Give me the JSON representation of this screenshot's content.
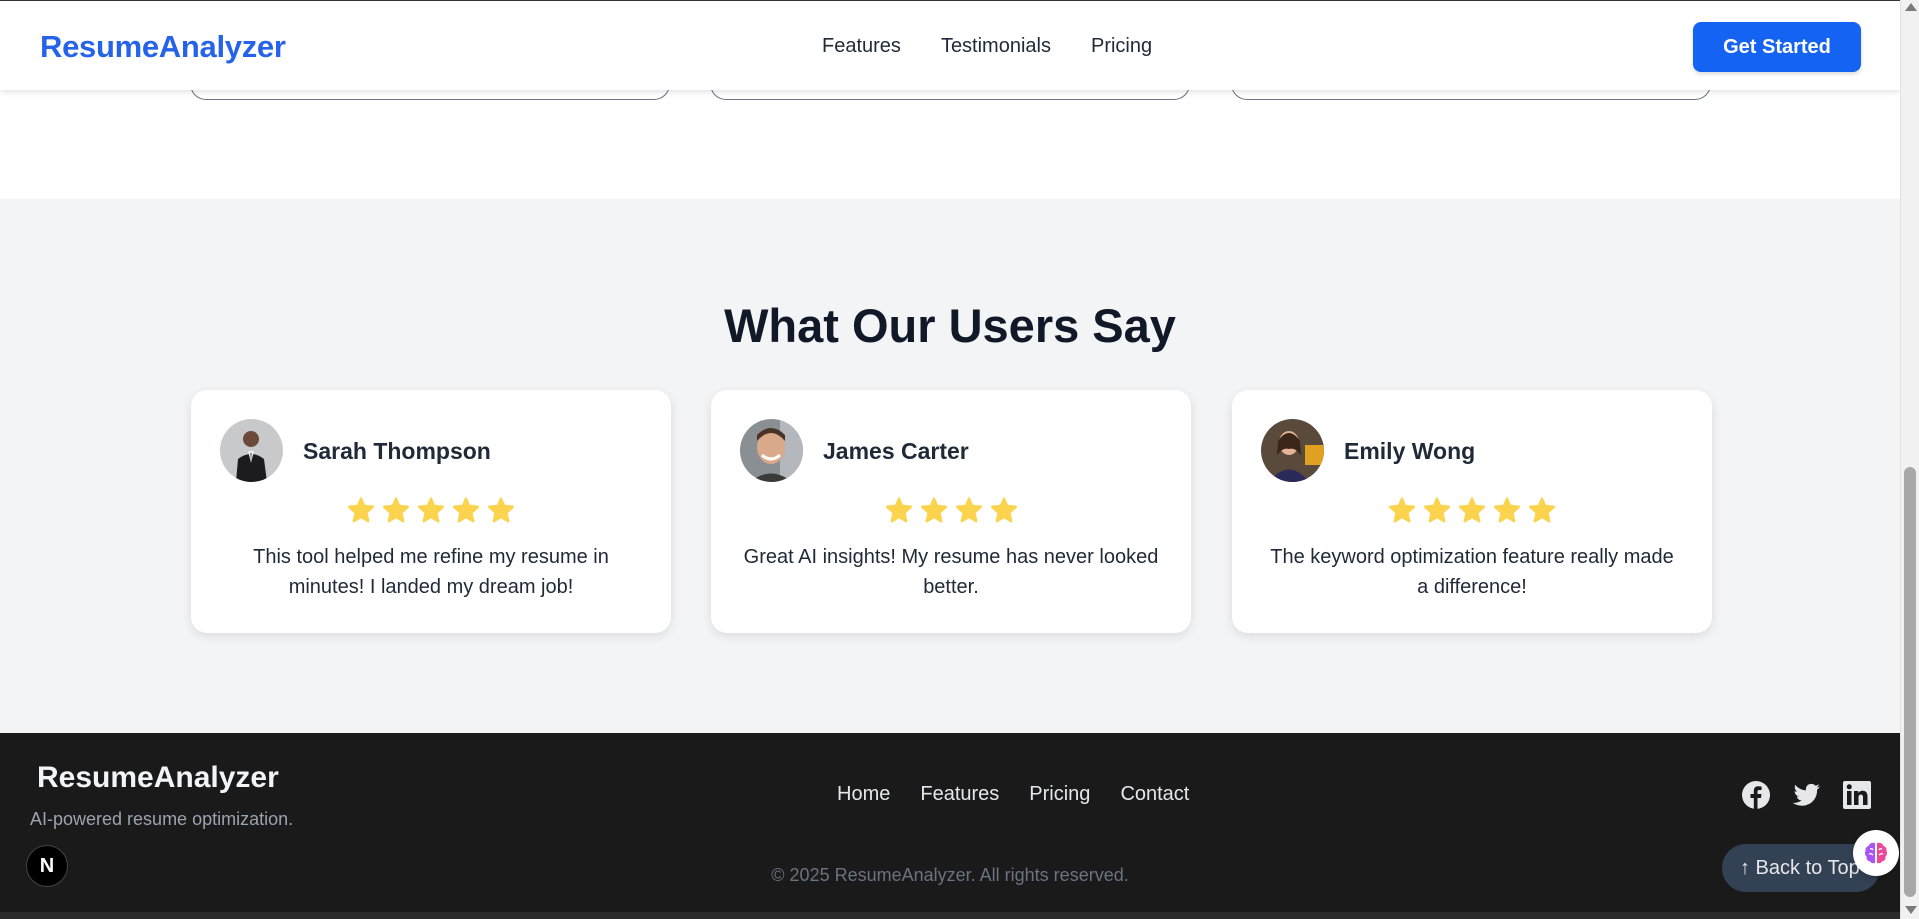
{
  "navbar": {
    "brand": "ResumeAnalyzer",
    "links": [
      "Features",
      "Testimonials",
      "Pricing"
    ],
    "cta_label": "Get Started"
  },
  "testimonials": {
    "title": "What Our Users Say",
    "cards": [
      {
        "name": "Sarah Thompson",
        "rating": 5,
        "quote": "This tool helped me refine my resume in minutes! I landed my dream job!"
      },
      {
        "name": "James Carter",
        "rating": 4,
        "quote": "Great AI insights! My resume has never looked better."
      },
      {
        "name": "Emily Wong",
        "rating": 5,
        "quote": "The keyword optimization feature really made a difference!"
      }
    ]
  },
  "footer": {
    "brand": "ResumeAnalyzer",
    "tagline": "AI-powered resume optimization.",
    "links": [
      "Home",
      "Features",
      "Pricing",
      "Contact"
    ],
    "social_icons": [
      "facebook-icon",
      "twitter-icon",
      "linkedin-icon"
    ],
    "copyright": "© 2025 ResumeAnalyzer. All rights reserved.",
    "back_to_top": "↑ Back to Top"
  },
  "dev_badge": {
    "label": "N"
  },
  "colors": {
    "brand": "#2563eb",
    "cta": "#1463f3",
    "star": "#fcd34d",
    "section_bg": "#f3f4f6",
    "footer_bg": "#1a1a1a"
  }
}
